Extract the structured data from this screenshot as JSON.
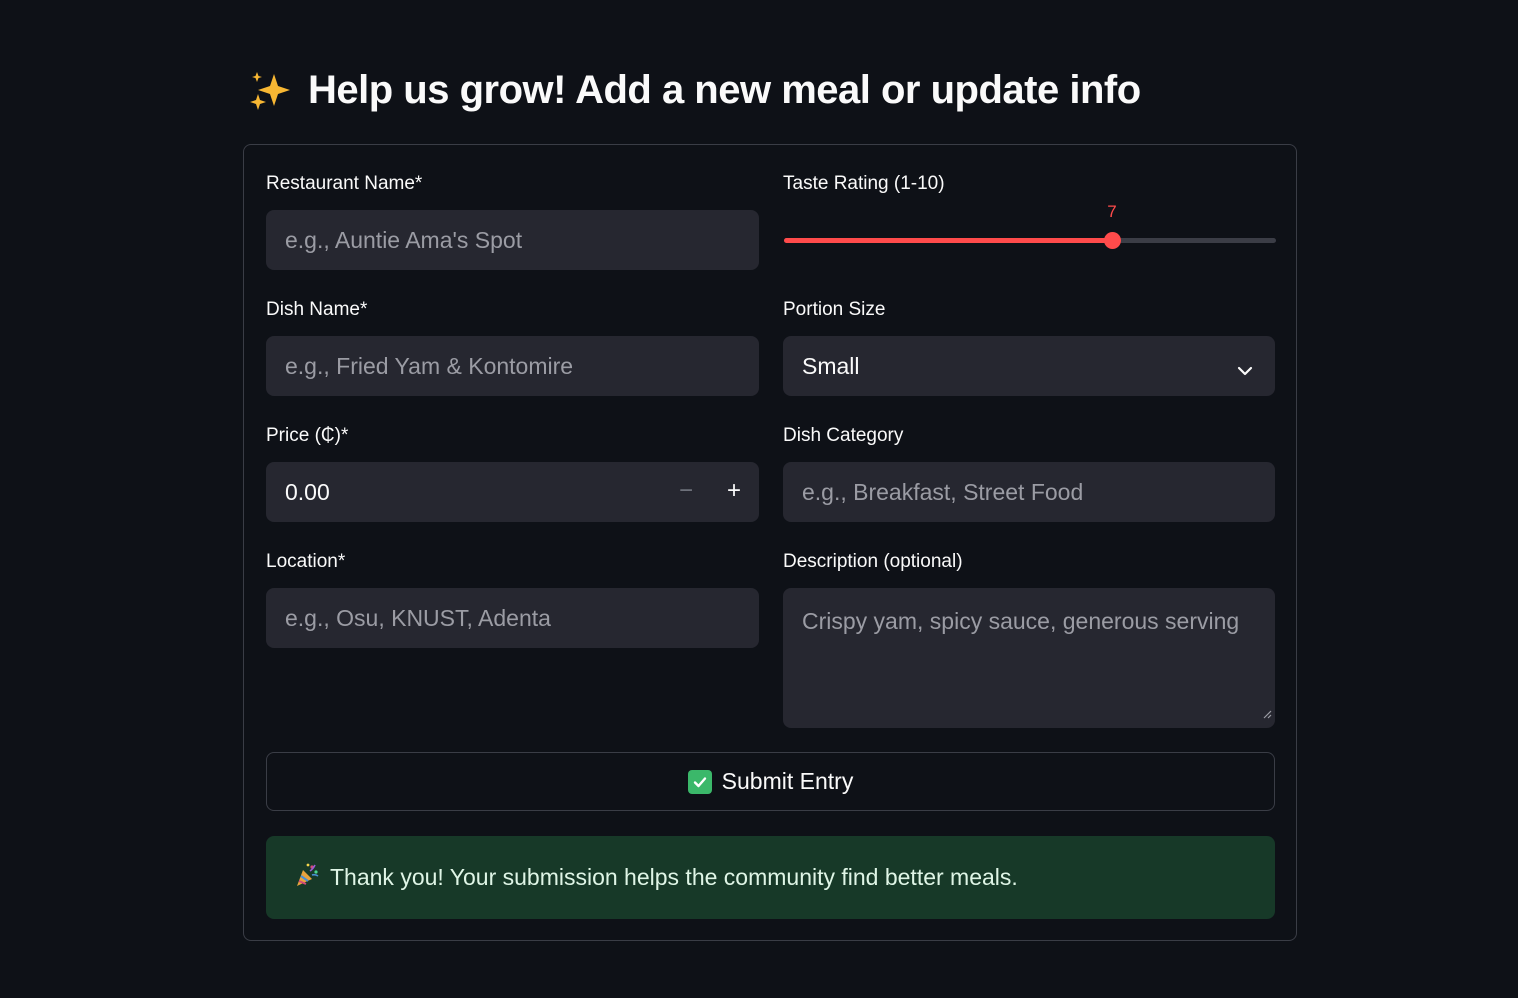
{
  "header": {
    "icon": "sparkles-icon",
    "title": "Help us grow! Add a new meal or update info"
  },
  "form": {
    "restaurant": {
      "label": "Restaurant Name*",
      "placeholder": "e.g., Auntie Ama's Spot"
    },
    "taste": {
      "label": "Taste Rating (1-10)",
      "value": "7",
      "min": 1,
      "max": 10,
      "accent": "#ff4b4b"
    },
    "dish": {
      "label": "Dish Name*",
      "placeholder": "e.g., Fried Yam & Kontomire"
    },
    "portion": {
      "label": "Portion Size",
      "selected": "Small",
      "icon": "chevron-down-icon"
    },
    "price": {
      "label": "Price (₵)*",
      "value": "0.00",
      "minus": "−",
      "plus": "+"
    },
    "category": {
      "label": "Dish Category",
      "placeholder": "e.g., Breakfast, Street Food"
    },
    "location": {
      "label": "Location*",
      "placeholder": "e.g., Osu, KNUST, Adenta"
    },
    "description": {
      "label": "Description (optional)",
      "placeholder": "Crispy yam, spicy sauce, generous serving"
    },
    "submit": {
      "icon": "checkmark-box-icon",
      "label": "Submit Entry"
    },
    "success": {
      "icon": "party-popper-icon",
      "message": "Thank you! Your submission helps the community find better meals.",
      "color": "#173928"
    }
  }
}
